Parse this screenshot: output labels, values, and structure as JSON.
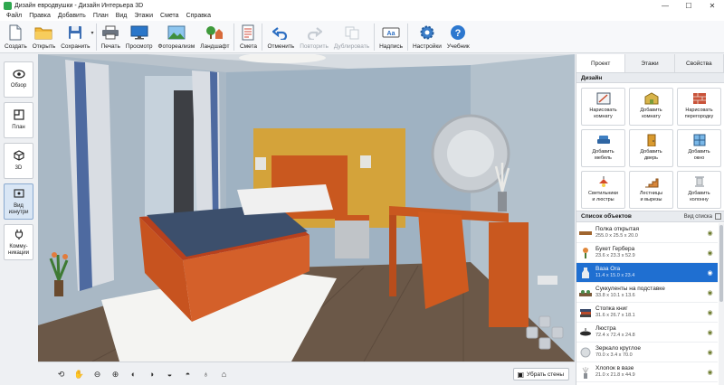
{
  "window": {
    "title": "Дизайн евродвушки - Дизайн Интерьера 3D",
    "minimize": "—",
    "maximize": "☐",
    "close": "✕"
  },
  "menu": [
    "Файл",
    "Правка",
    "Добавить",
    "План",
    "Вид",
    "Этажи",
    "Смета",
    "Справка"
  ],
  "toolbar": {
    "create": "Создать",
    "open": "Открыть",
    "save": "Сохранить",
    "print": "Печать",
    "preview": "Просмотр",
    "photorealism": "Фотореализм",
    "landscape": "Ландшафт",
    "estimate": "Смета",
    "undo": "Отменить",
    "redo": "Повторить",
    "duplicate": "Дублировать",
    "caption": "Надпись",
    "settings": "Настройки",
    "tutorial": "Учебник"
  },
  "left_nav": {
    "overview": "Обзор",
    "plan": "План",
    "view3d": "3D",
    "inside_line1": "Вид",
    "inside_line2": "изнутри",
    "comm_line1": "Комму-",
    "comm_line2": "никации"
  },
  "bottom": {
    "remove_walls": "Убрать стены"
  },
  "tabs": {
    "project": "Проект",
    "floors": "Этажи",
    "properties": "Свойства"
  },
  "design": {
    "header": "Дизайн",
    "items": [
      {
        "line1": "Нарисовать",
        "line2": "комнату"
      },
      {
        "line1": "Добавить",
        "line2": "комнату"
      },
      {
        "line1": "Нарисовать",
        "line2": "перегородку"
      },
      {
        "line1": "Добавить",
        "line2": "мебель"
      },
      {
        "line1": "Добавить",
        "line2": "дверь"
      },
      {
        "line1": "Добавить",
        "line2": "окно"
      },
      {
        "line1": "Светильники",
        "line2": "и люстры"
      },
      {
        "line1": "Лестницы",
        "line2": "и вырезы"
      },
      {
        "line1": "Добавить",
        "line2": "колонну"
      }
    ]
  },
  "objects": {
    "header": "Список объектов",
    "view_list": "Вид списка",
    "items": [
      {
        "name": "Полка открытая",
        "dims": "255.0 x 25.5 x 20.0"
      },
      {
        "name": "Букет Гербера",
        "dims": "23.6 x 23.3 x 52.9"
      },
      {
        "name": "Ваза Ora",
        "dims": "11.4 x 15.0 x 23.4"
      },
      {
        "name": "Суккуленты на подставке",
        "dims": "33.8 x 10.1 x 13.6"
      },
      {
        "name": "Стопка книг",
        "dims": "31.6 x 26.7 x 18.1"
      },
      {
        "name": "Люстра",
        "dims": "72.4 x 72.4 x 24.8"
      },
      {
        "name": "Зеркало круглое",
        "dims": "70.0 x 3.4 x 70.0"
      },
      {
        "name": "Хлопок в вазе",
        "dims": "21.0 x 21.8 x 44.9"
      }
    ]
  }
}
